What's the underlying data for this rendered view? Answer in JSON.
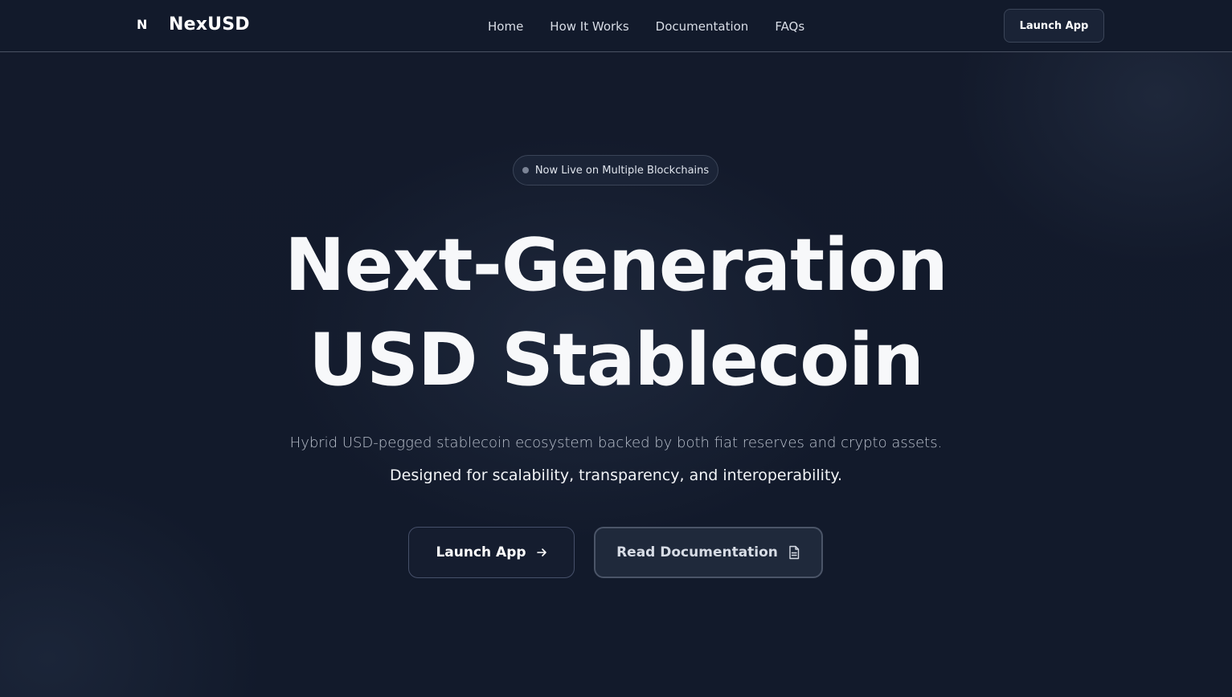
{
  "header": {
    "logo_mark": "N",
    "brand": "NexUSD",
    "nav": [
      {
        "label": "Home"
      },
      {
        "label": "How It Works"
      },
      {
        "label": "Documentation"
      },
      {
        "label": "FAQs"
      }
    ],
    "cta_label": "Launch App"
  },
  "hero": {
    "badge": "Now Live on Multiple Blockchains",
    "headline_line1": "Next-Generation",
    "headline_line2": "USD Stablecoin",
    "subtitle1": "Hybrid USD-pegged stablecoin ecosystem backed by both fiat reserves and crypto assets.",
    "subtitle2": "Designed for scalability, transparency, and interoperability.",
    "primary_button": {
      "label": "Launch App",
      "icon": "arrow-right-icon"
    },
    "secondary_button": {
      "label": "Read Documentation",
      "icon": "document-icon"
    }
  },
  "colors": {
    "background": "#121a2b",
    "border": "#4a5263",
    "text": "#f7f8fa"
  }
}
